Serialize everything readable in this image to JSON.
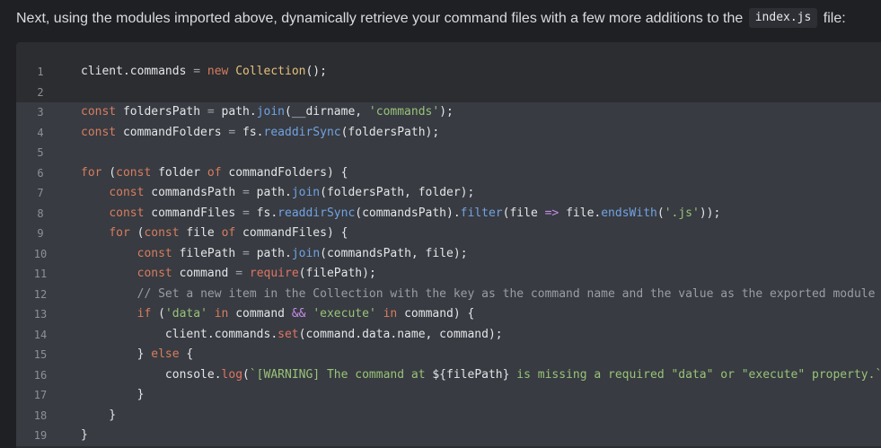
{
  "intro": {
    "text_before": "Next, using the modules imported above, dynamically retrieve your command files with a few more additions to the ",
    "code": "index.js",
    "text_after": " file:"
  },
  "code": {
    "highlighted_lines": [
      3,
      4,
      5,
      6,
      7,
      8,
      9,
      10,
      11,
      12,
      13,
      14,
      15,
      16,
      17,
      18,
      19
    ],
    "lines": [
      [
        {
          "t": "client.commands ",
          "c": ""
        },
        {
          "t": "=",
          "c": "op"
        },
        {
          "t": " ",
          "c": ""
        },
        {
          "t": "new",
          "c": "kw"
        },
        {
          "t": " ",
          "c": ""
        },
        {
          "t": "Collection",
          "c": "cls"
        },
        {
          "t": "();",
          "c": ""
        }
      ],
      [],
      [
        {
          "t": "const",
          "c": "kw"
        },
        {
          "t": " foldersPath ",
          "c": ""
        },
        {
          "t": "=",
          "c": "op"
        },
        {
          "t": " path.",
          "c": ""
        },
        {
          "t": "join",
          "c": "fn"
        },
        {
          "t": "(__dirname, ",
          "c": ""
        },
        {
          "t": "'commands'",
          "c": "str"
        },
        {
          "t": ");",
          "c": ""
        }
      ],
      [
        {
          "t": "const",
          "c": "kw"
        },
        {
          "t": " commandFolders ",
          "c": ""
        },
        {
          "t": "=",
          "c": "op"
        },
        {
          "t": " fs.",
          "c": ""
        },
        {
          "t": "readdirSync",
          "c": "fn"
        },
        {
          "t": "(foldersPath);",
          "c": ""
        }
      ],
      [],
      [
        {
          "t": "for",
          "c": "kw"
        },
        {
          "t": " (",
          "c": ""
        },
        {
          "t": "const",
          "c": "kw"
        },
        {
          "t": " folder ",
          "c": ""
        },
        {
          "t": "of",
          "c": "kw"
        },
        {
          "t": " commandFolders) {",
          "c": ""
        }
      ],
      [
        {
          "t": "    ",
          "c": ""
        },
        {
          "t": "const",
          "c": "kw"
        },
        {
          "t": " commandsPath ",
          "c": ""
        },
        {
          "t": "=",
          "c": "op"
        },
        {
          "t": " path.",
          "c": ""
        },
        {
          "t": "join",
          "c": "fn"
        },
        {
          "t": "(foldersPath, folder);",
          "c": ""
        }
      ],
      [
        {
          "t": "    ",
          "c": ""
        },
        {
          "t": "const",
          "c": "kw"
        },
        {
          "t": " commandFiles ",
          "c": ""
        },
        {
          "t": "=",
          "c": "op"
        },
        {
          "t": " fs.",
          "c": ""
        },
        {
          "t": "readdirSync",
          "c": "fn"
        },
        {
          "t": "(commandsPath).",
          "c": ""
        },
        {
          "t": "filter",
          "c": "fn"
        },
        {
          "t": "(file ",
          "c": ""
        },
        {
          "t": "=>",
          "c": "kw2"
        },
        {
          "t": " file.",
          "c": ""
        },
        {
          "t": "endsWith",
          "c": "fn"
        },
        {
          "t": "(",
          "c": ""
        },
        {
          "t": "'.js'",
          "c": "str"
        },
        {
          "t": "));",
          "c": ""
        }
      ],
      [
        {
          "t": "    ",
          "c": ""
        },
        {
          "t": "for",
          "c": "kw"
        },
        {
          "t": " (",
          "c": ""
        },
        {
          "t": "const",
          "c": "kw"
        },
        {
          "t": " file ",
          "c": ""
        },
        {
          "t": "of",
          "c": "kw"
        },
        {
          "t": " commandFiles) {",
          "c": ""
        }
      ],
      [
        {
          "t": "        ",
          "c": ""
        },
        {
          "t": "const",
          "c": "kw"
        },
        {
          "t": " filePath ",
          "c": ""
        },
        {
          "t": "=",
          "c": "op"
        },
        {
          "t": " path.",
          "c": ""
        },
        {
          "t": "join",
          "c": "fn"
        },
        {
          "t": "(commandsPath, file);",
          "c": ""
        }
      ],
      [
        {
          "t": "        ",
          "c": ""
        },
        {
          "t": "const",
          "c": "kw"
        },
        {
          "t": " command ",
          "c": ""
        },
        {
          "t": "=",
          "c": "op"
        },
        {
          "t": " ",
          "c": ""
        },
        {
          "t": "require",
          "c": "call"
        },
        {
          "t": "(filePath);",
          "c": ""
        }
      ],
      [
        {
          "t": "        ",
          "c": ""
        },
        {
          "t": "// Set a new item in the Collection with the key as the command name and the value as the exported module",
          "c": "cm"
        }
      ],
      [
        {
          "t": "        ",
          "c": ""
        },
        {
          "t": "if",
          "c": "kw"
        },
        {
          "t": " (",
          "c": ""
        },
        {
          "t": "'data'",
          "c": "str"
        },
        {
          "t": " ",
          "c": ""
        },
        {
          "t": "in",
          "c": "kw"
        },
        {
          "t": " command ",
          "c": ""
        },
        {
          "t": "&&",
          "c": "kw2"
        },
        {
          "t": " ",
          "c": ""
        },
        {
          "t": "'execute'",
          "c": "str"
        },
        {
          "t": " ",
          "c": ""
        },
        {
          "t": "in",
          "c": "kw"
        },
        {
          "t": " command) {",
          "c": ""
        }
      ],
      [
        {
          "t": "            client.commands.",
          "c": ""
        },
        {
          "t": "set",
          "c": "call"
        },
        {
          "t": "(command.data.name, command);",
          "c": ""
        }
      ],
      [
        {
          "t": "        } ",
          "c": ""
        },
        {
          "t": "else",
          "c": "kw"
        },
        {
          "t": " {",
          "c": ""
        }
      ],
      [
        {
          "t": "            console.",
          "c": ""
        },
        {
          "t": "log",
          "c": "call"
        },
        {
          "t": "(",
          "c": ""
        },
        {
          "t": "`[WARNING] The command at ",
          "c": "str"
        },
        {
          "t": "${filePath}",
          "c": ""
        },
        {
          "t": " is missing a required \"data\" or \"execute\" property.`",
          "c": "str"
        },
        {
          "t": ");",
          "c": ""
        }
      ],
      [
        {
          "t": "        }",
          "c": ""
        }
      ],
      [
        {
          "t": "    }",
          "c": ""
        }
      ],
      [
        {
          "t": "}",
          "c": ""
        }
      ]
    ]
  }
}
